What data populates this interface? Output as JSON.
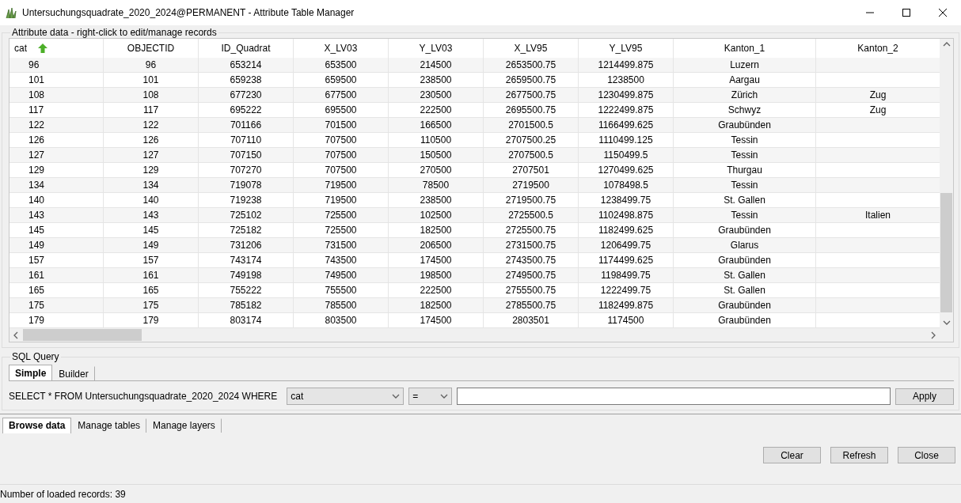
{
  "window": {
    "title": "Untersuchungsquadrate_2020_2024@PERMANENT - Attribute Table Manager"
  },
  "attribute_group": {
    "title": "Attribute data - right-click to edit/manage records"
  },
  "table": {
    "columns": [
      {
        "label": "cat",
        "sorted": true
      },
      {
        "label": "OBJECTID",
        "sorted": false
      },
      {
        "label": "ID_Quadrat",
        "sorted": false
      },
      {
        "label": "X_LV03",
        "sorted": false
      },
      {
        "label": "Y_LV03",
        "sorted": false
      },
      {
        "label": "X_LV95",
        "sorted": false
      },
      {
        "label": "Y_LV95",
        "sorted": false
      },
      {
        "label": "Kanton_1",
        "sorted": false
      },
      {
        "label": "Kanton_2",
        "sorted": false
      }
    ],
    "rows": [
      [
        "96",
        "96",
        "653214",
        "653500",
        "214500",
        "2653500.75",
        "1214499.875",
        "Luzern",
        null
      ],
      [
        "101",
        "101",
        "659238",
        "659500",
        "238500",
        "2659500.75",
        "1238500",
        "Aargau",
        null
      ],
      [
        "108",
        "108",
        "677230",
        "677500",
        "230500",
        "2677500.75",
        "1230499.875",
        "Zürich",
        "Zug"
      ],
      [
        "117",
        "117",
        "695222",
        "695500",
        "222500",
        "2695500.75",
        "1222499.875",
        "Schwyz",
        "Zug"
      ],
      [
        "122",
        "122",
        "701166",
        "701500",
        "166500",
        "2701500.5",
        "1166499.625",
        "Graubünden",
        null
      ],
      [
        "126",
        "126",
        "707110",
        "707500",
        "110500",
        "2707500.25",
        "1110499.125",
        "Tessin",
        null
      ],
      [
        "127",
        "127",
        "707150",
        "707500",
        "150500",
        "2707500.5",
        "1150499.5",
        "Tessin",
        null
      ],
      [
        "129",
        "129",
        "707270",
        "707500",
        "270500",
        "2707501",
        "1270499.625",
        "Thurgau",
        null
      ],
      [
        "134",
        "134",
        "719078",
        "719500",
        "78500",
        "2719500",
        "1078498.5",
        "Tessin",
        null
      ],
      [
        "140",
        "140",
        "719238",
        "719500",
        "238500",
        "2719500.75",
        "1238499.75",
        "St. Gallen",
        null
      ],
      [
        "143",
        "143",
        "725102",
        "725500",
        "102500",
        "2725500.5",
        "1102498.875",
        "Tessin",
        "Italien"
      ],
      [
        "145",
        "145",
        "725182",
        "725500",
        "182500",
        "2725500.75",
        "1182499.625",
        "Graubünden",
        null
      ],
      [
        "149",
        "149",
        "731206",
        "731500",
        "206500",
        "2731500.75",
        "1206499.75",
        "Glarus",
        null
      ],
      [
        "157",
        "157",
        "743174",
        "743500",
        "174500",
        "2743500.75",
        "1174499.625",
        "Graubünden",
        null
      ],
      [
        "161",
        "161",
        "749198",
        "749500",
        "198500",
        "2749500.75",
        "1198499.75",
        "St. Gallen",
        null
      ],
      [
        "165",
        "165",
        "755222",
        "755500",
        "222500",
        "2755500.75",
        "1222499.75",
        "St. Gallen",
        null
      ],
      [
        "175",
        "175",
        "785182",
        "785500",
        "182500",
        "2785500.75",
        "1182499.875",
        "Graubünden",
        null
      ],
      [
        "179",
        "179",
        "803174",
        "803500",
        "174500",
        "2803501",
        "1174500",
        "Graubünden",
        null
      ]
    ]
  },
  "sql_query": {
    "title": "SQL Query",
    "tabs": [
      {
        "label": "Simple",
        "selected": true
      },
      {
        "label": "Builder",
        "selected": false
      }
    ],
    "prefix": "SELECT * FROM Untersuchungsquadrate_2020_2024 WHERE",
    "column_select": "cat",
    "operator_select": "=",
    "apply_button": "Apply"
  },
  "bottom_tabs": [
    {
      "label": "Browse data",
      "selected": true
    },
    {
      "label": "Manage tables",
      "selected": false
    },
    {
      "label": "Manage layers",
      "selected": false
    }
  ],
  "buttons": [
    "Clear",
    "Refresh",
    "Close"
  ],
  "status_bar": "Number of loaded records: 39"
}
